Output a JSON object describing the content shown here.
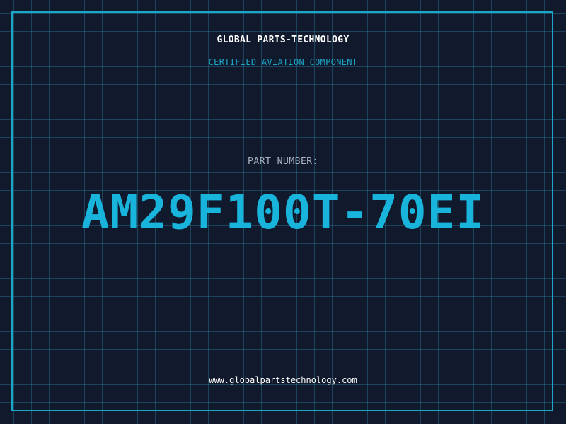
{
  "header": {
    "company": "GLOBAL PARTS-TECHNOLOGY",
    "tagline": "CERTIFIED AVIATION COMPONENT"
  },
  "part": {
    "label": "PART NUMBER:",
    "number": "AM29F100T-70EI"
  },
  "footer": {
    "website": "www.globalpartstechnology.com"
  },
  "colors": {
    "background": "#111a2c",
    "grid": "#2d7896",
    "accent": "#1ca6c8",
    "part_number": "#18b4dc",
    "label": "#a9b4c2",
    "text": "#ffffff"
  }
}
